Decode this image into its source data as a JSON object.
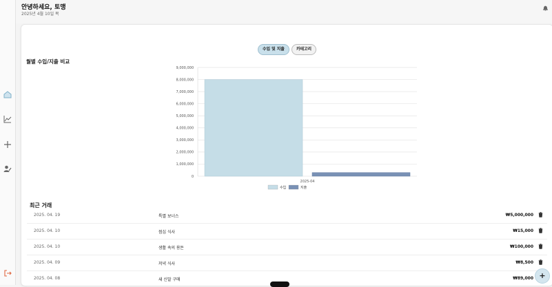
{
  "header": {
    "greeting": "안녕하세요, 토맹",
    "date": "2025년 4월 10일 목",
    "icon": "bell-icon"
  },
  "sidebar": {
    "items": [
      "home-icon",
      "chart-icon",
      "plus-icon",
      "user-edit-icon"
    ],
    "logout_icon": "logout-icon"
  },
  "tabs": [
    {
      "label": "수입 및 지출",
      "active": true
    },
    {
      "label": "카테고리",
      "active": false
    }
  ],
  "chart_title": "월별 수입/지출 비교",
  "chart_data": {
    "type": "bar",
    "categories": [
      "2025-04"
    ],
    "series": [
      {
        "name": "수입",
        "values": [
          8000000
        ],
        "color": "#c5dde7"
      },
      {
        "name": "지출",
        "values": [
          300000
        ],
        "color": "#7991b5"
      }
    ],
    "ylim": [
      0,
      9000000
    ],
    "yticks": [
      "0",
      "1,000,000",
      "2,000,000",
      "3,000,000",
      "4,000,000",
      "5,000,000",
      "6,000,000",
      "7,000,000",
      "8,000,000",
      "9,000,000"
    ],
    "grid": true,
    "legend": "bottom"
  },
  "recent": {
    "title": "최근 거래",
    "rows": [
      {
        "date": "2025. 04. 19",
        "name": "특별 보너스",
        "amount": "₩5,000,000"
      },
      {
        "date": "2025. 04. 10",
        "name": "점심 식사",
        "amount": "₩15,000"
      },
      {
        "date": "2025. 04. 10",
        "name": "생활 속의 용돈",
        "amount": "₩100,000"
      },
      {
        "date": "2025. 04. 09",
        "name": "저녁 식사",
        "amount": "₩8,500"
      },
      {
        "date": "2025. 04. 08",
        "name": "새 신발 구매",
        "amount": "₩89,000"
      }
    ]
  },
  "fab_label": "+"
}
